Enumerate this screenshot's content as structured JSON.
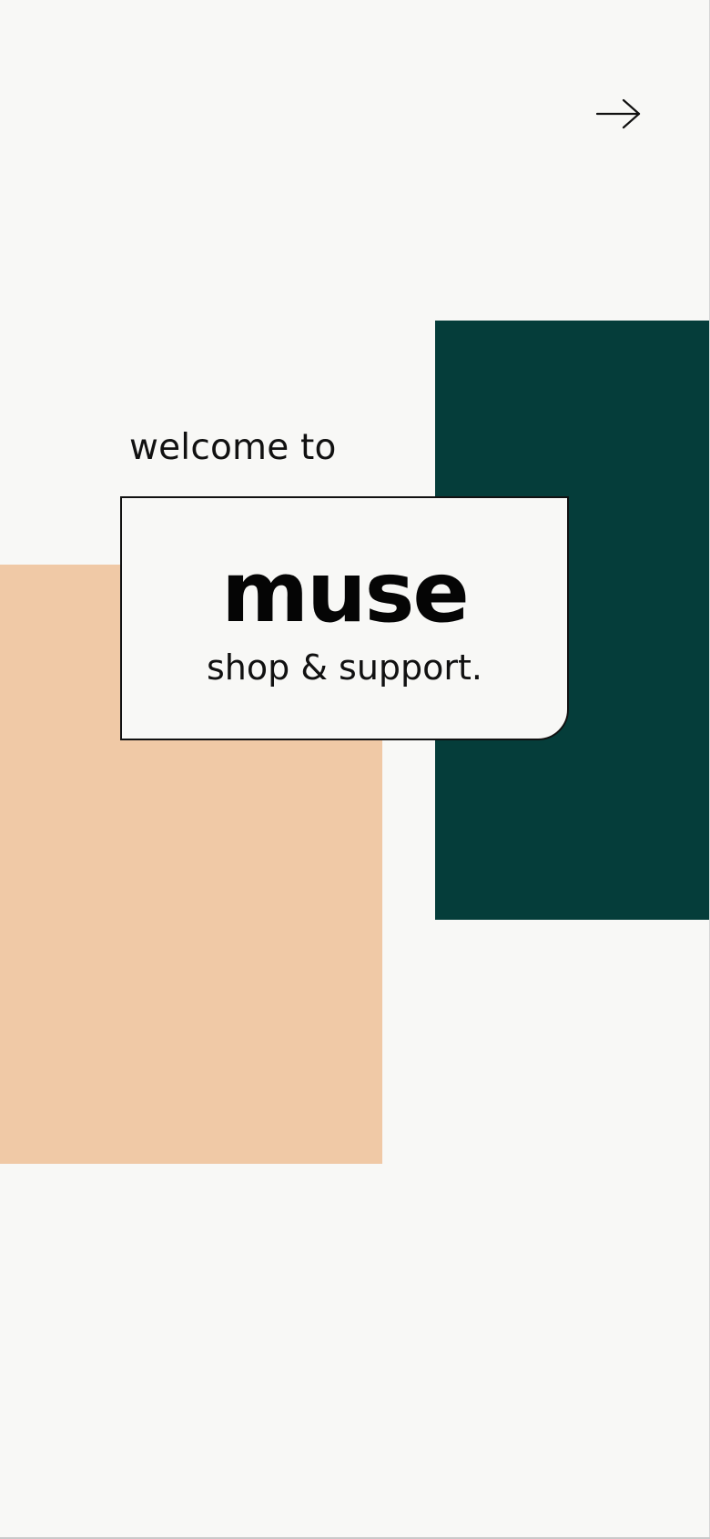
{
  "app": {
    "welcome_text": "welcome to",
    "brand_name": "muse",
    "tagline": "shop & support."
  },
  "navigation": {
    "next_icon": "right-arrow-icon"
  },
  "colors": {
    "background": "#f8f8f6",
    "accent_green": "#053d3a",
    "accent_peach": "#f0c9a6",
    "text": "#111111"
  }
}
